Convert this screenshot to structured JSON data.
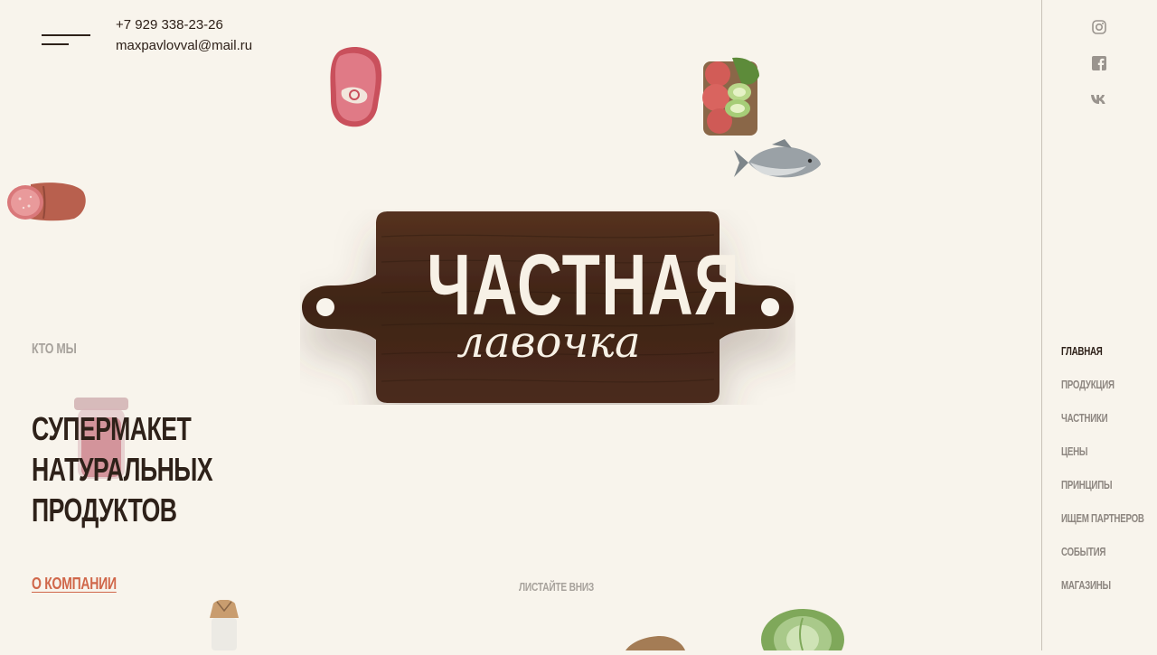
{
  "header": {
    "phone": "+7 929 338-23-26",
    "email": "maxpavlovval@mail.ru"
  },
  "social": [
    "instagram-icon",
    "facebook-icon",
    "vk-icon"
  ],
  "nav": {
    "items": [
      {
        "label": "ГЛАВНАЯ",
        "active": true
      },
      {
        "label": "ПРОДУКЦИЯ"
      },
      {
        "label": "ЧАСТНИКИ"
      },
      {
        "label": "ЦЕНЫ"
      },
      {
        "label": "ПРИНЦИПЫ"
      },
      {
        "label": "ИЩЕМ ПАРТНЕРОВ"
      },
      {
        "label": "СОБЫТИЯ"
      },
      {
        "label": "МАГАЗИНЫ"
      }
    ]
  },
  "hero": {
    "section_label": "КТО МЫ",
    "headline_lines": [
      "СУПЕРМАКЕТ",
      "НАТУРАЛЬНЫХ",
      "ПРОДУКТОВ"
    ],
    "about_link": "О КОМПАНИИ",
    "scroll_hint": "ЛИСТАЙТЕ ВНИЗ"
  },
  "logo": {
    "line1": "ЧАСТНАЯ",
    "line2": "лавочка"
  },
  "colors": {
    "background": "#f8f4ec",
    "text_dark": "#2e2119",
    "accent_link": "#d0674a",
    "muted": "#a7a29c",
    "board": "#4a2a1b"
  }
}
